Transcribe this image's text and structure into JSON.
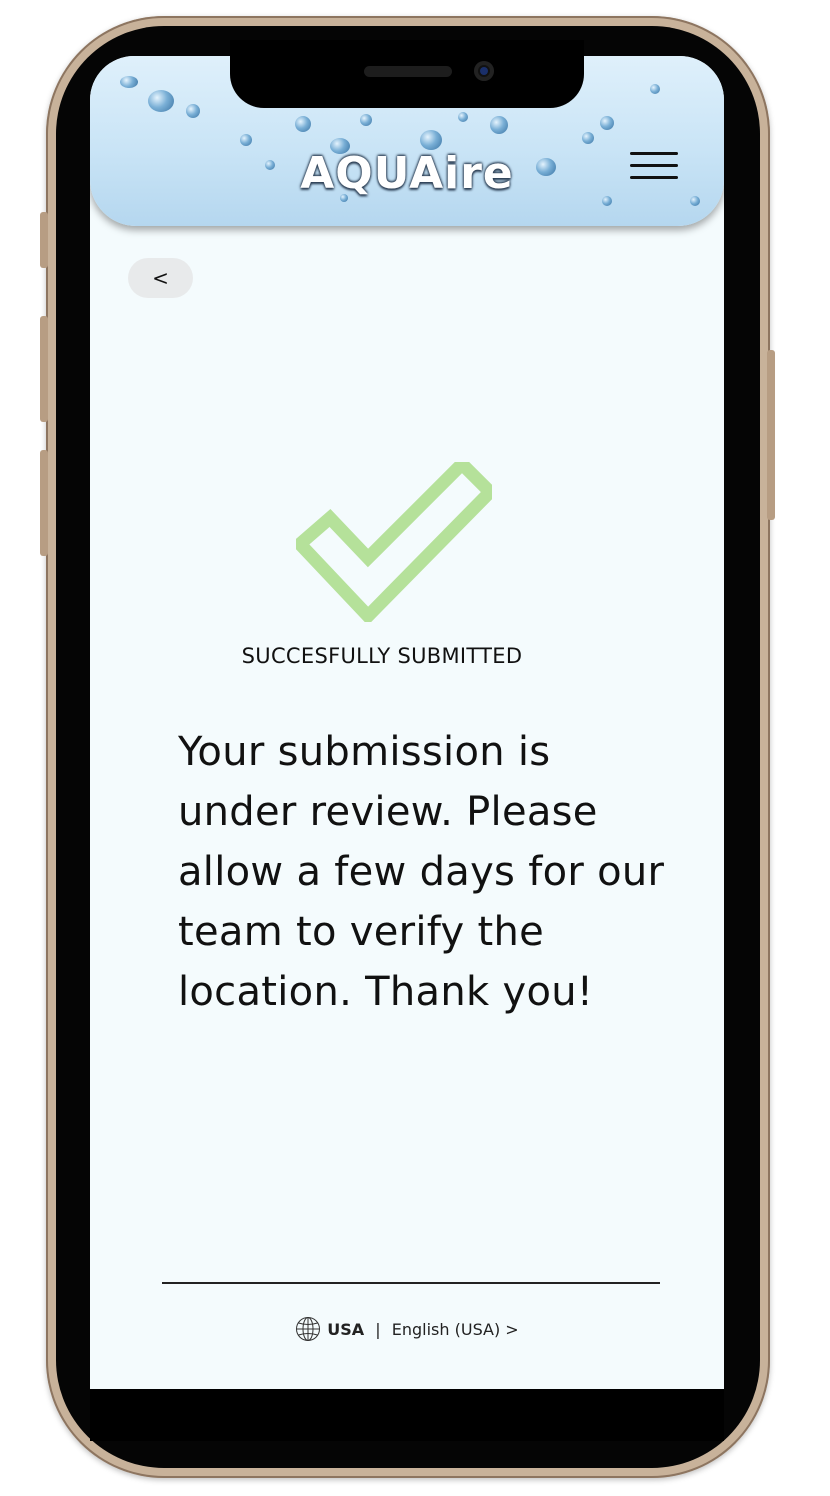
{
  "header": {
    "brand": "AQUAire",
    "menu_icon": "hamburger-menu-icon"
  },
  "nav": {
    "back_label": "<"
  },
  "confirmation": {
    "icon": "checkmark-icon",
    "icon_color": "#b5e19a",
    "status": "SUCCESFULLY SUBMITTED",
    "message": "Your submission is under review. Please allow a few days for our team to verify the location. Thank you!"
  },
  "footer": {
    "icon": "globe-icon",
    "country": "USA",
    "separator": " | ",
    "language": "English (USA) >"
  }
}
